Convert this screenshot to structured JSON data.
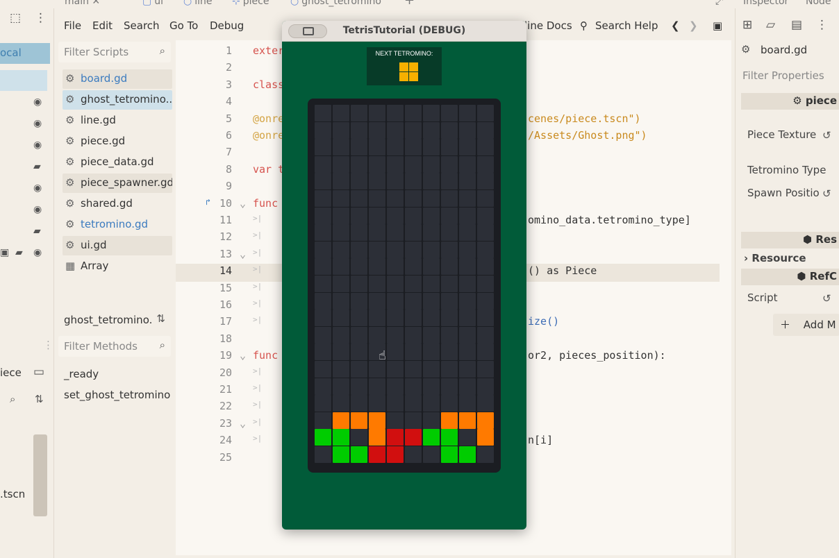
{
  "tabs": [
    "main",
    "ui",
    "line",
    "piece",
    "ghost_tetromino"
  ],
  "filesystem": {
    "local_label": "ocal",
    "piece_label": "iece",
    "tscn_label": ".tscn"
  },
  "menu": [
    "File",
    "Edit",
    "Search",
    "Go To",
    "Debug"
  ],
  "toolbar": {
    "online_docs": "line Docs",
    "search_help": "Search Help"
  },
  "scripts": {
    "filter_placeholder": "Filter Scripts",
    "items": [
      {
        "name": "board.gd",
        "style": "blue shade"
      },
      {
        "name": "ghost_tetromino...",
        "style": "sel"
      },
      {
        "name": "line.gd",
        "style": ""
      },
      {
        "name": "piece.gd",
        "style": ""
      },
      {
        "name": "piece_data.gd",
        "style": ""
      },
      {
        "name": "piece_spawner.gd",
        "style": "shade"
      },
      {
        "name": "shared.gd",
        "style": ""
      },
      {
        "name": "tetromino.gd",
        "style": "blue"
      },
      {
        "name": "ui.gd",
        "style": "shade"
      },
      {
        "name": "Array",
        "style": ""
      }
    ],
    "current_script": "ghost_tetromino.",
    "methods_placeholder": "Filter Methods",
    "methods": [
      "_ready",
      "set_ghost_tetromino"
    ]
  },
  "code": {
    "line_numbers": [
      "1",
      "2",
      "3",
      "4",
      "5",
      "6",
      "7",
      "8",
      "9",
      "10",
      "11",
      "12",
      "13",
      "14",
      "15",
      "16",
      "17",
      "18",
      "19",
      "20",
      "21",
      "22",
      "23",
      "24",
      "25"
    ],
    "left_fragments": [
      {
        "line": 1,
        "text": "exter",
        "color": "#d6534e"
      },
      {
        "line": 3,
        "text": "class",
        "color": "#d6534e"
      },
      {
        "line": 5,
        "text": "@onre",
        "color": "#d4a444"
      },
      {
        "line": 6,
        "text": "@onre",
        "color": "#d4a444"
      },
      {
        "line": 8,
        "text": "var t",
        "color": "#d6534e"
      },
      {
        "line": 10,
        "text": "func",
        "color": "#d6534e"
      },
      {
        "line": 19,
        "text": "func",
        "color": "#d6534e"
      }
    ],
    "right_fragments": [
      {
        "line": 5,
        "text": "cenes/piece.tscn\")",
        "color": "#c98a1e"
      },
      {
        "line": 6,
        "text": "/Assets/Ghost.png\")",
        "color": "#c98a1e"
      },
      {
        "line": 11,
        "text": "omino_data.tetromino_type]",
        "color": "#333333"
      },
      {
        "line": 14,
        "text": "() as Piece",
        "color": "#333333"
      },
      {
        "line": 17,
        "text": "ize()",
        "color": "#3b6bb5"
      },
      {
        "line": 19,
        "text": "or2, pieces_position):",
        "color": "#333333"
      },
      {
        "line": 24,
        "text": "n[i]",
        "color": "#333333"
      }
    ]
  },
  "inspector": {
    "tabs": [
      "Inspector",
      "Node"
    ],
    "file": "board.gd",
    "filter_placeholder": "Filter Properties",
    "section_piece": "piece",
    "piece_texture": "Piece Texture",
    "tetromino_type": "Tetromino Type",
    "spawn_position": "Spawn Positio",
    "section_res": "Res",
    "resource": "Resource",
    "section_ref": "RefC",
    "script": "Script",
    "add": "Add M"
  },
  "game": {
    "title": "TetrisTutorial (DEBUG)",
    "next_label": "NEXT TETROMINO:",
    "next_color": "#f7b000",
    "colors": {
      "O": "#ff7a00",
      "G": "#00cc00",
      "R": "#d10f0f"
    },
    "board_rows": [
      "..........",
      "..........",
      "..........",
      "..........",
      "..........",
      "..........",
      "..........",
      "..........",
      "..........",
      "..........",
      "..........",
      "..........",
      "..........",
      "..........",
      "..........",
      "..........",
      "..........",
      "..........",
      ".OOO...OOO",
      "GG.ORRGG.O",
      ".GGRR..GG."
    ]
  }
}
